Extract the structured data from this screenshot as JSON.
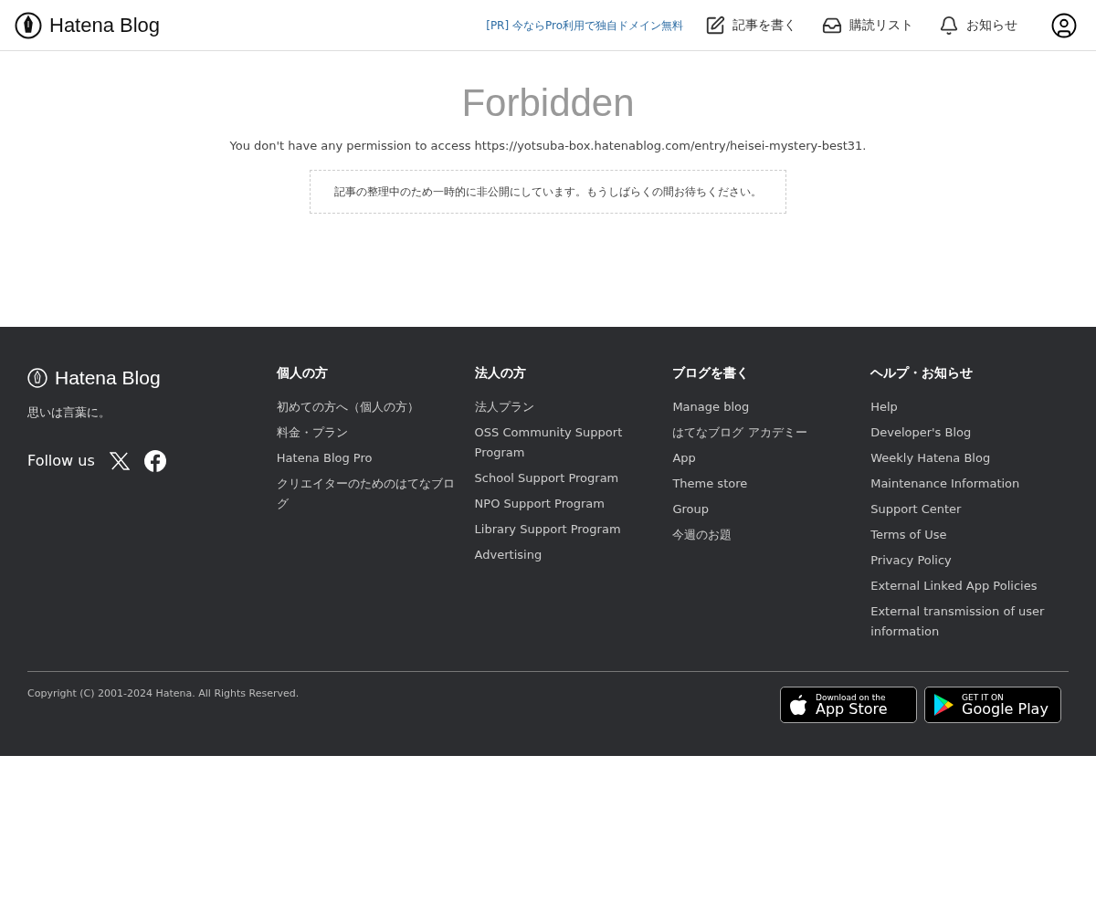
{
  "header": {
    "logo": "Hatena Blog",
    "promo": "[PR] 今ならPro利用で独自ドメイン無料",
    "nav": [
      {
        "kind": "write",
        "label": "記事を書く"
      },
      {
        "kind": "reading",
        "label": "購読リスト"
      },
      {
        "kind": "notice",
        "label": "お知らせ"
      }
    ]
  },
  "main": {
    "title": "Forbidden",
    "message": "You don't have any permission to access https://yotsuba-box.hatenablog.com/entry/heisei-mystery-best31.",
    "notice": "記事の整理中のため一時的に非公開にしています。もうしばらくの間お待ちください。"
  },
  "footer": {
    "logo": "Hatena Blog",
    "tagline": "思いは言葉に。",
    "follow": "Follow us",
    "columns": [
      {
        "heading": "個人の方",
        "links": [
          "初めての方へ（個人の方）",
          "料金・プラン",
          "Hatena Blog Pro",
          "クリエイターのためのはてなブログ"
        ]
      },
      {
        "heading": "法人の方",
        "links": [
          "法人プラン",
          "OSS Community Support Program",
          "School Support Program",
          "NPO Support Program",
          "Library Support Program",
          "Advertising"
        ]
      },
      {
        "heading": "ブログを書く",
        "links": [
          "Manage blog",
          "はてなブログ アカデミー",
          "App",
          "Theme store",
          "Group",
          "今週のお題"
        ]
      },
      {
        "heading": "ヘルプ・お知らせ",
        "links": [
          "Help",
          "Developer's Blog",
          "Weekly Hatena Blog",
          "Maintenance Information",
          "Support Center",
          "Terms of Use",
          "Privacy Policy",
          "External Linked App Policies",
          "External transmission of user information"
        ]
      }
    ],
    "copyright": "Copyright (C) 2001-2024 Hatena. All Rights Reserved.",
    "badges": [
      {
        "kind": "apple",
        "small": "Download on the",
        "big": "App Store"
      },
      {
        "kind": "google",
        "small": "GET IT ON",
        "big": "Google Play"
      }
    ]
  }
}
